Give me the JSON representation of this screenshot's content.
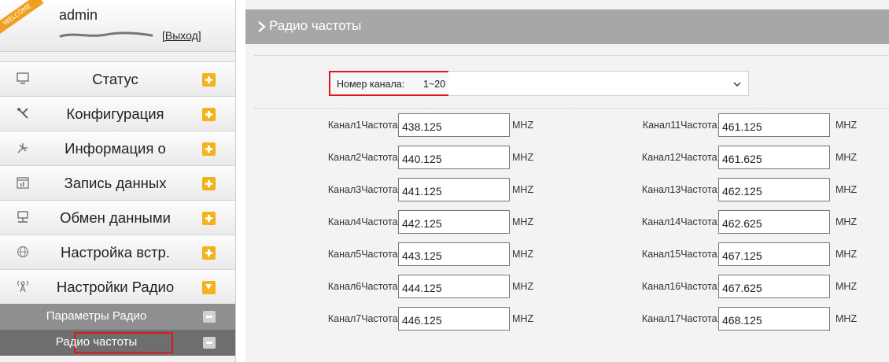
{
  "user": {
    "welcome_badge": "WELCOME",
    "name": "admin",
    "logout": "[Выход]"
  },
  "menu": [
    {
      "label": "Статус",
      "icon": "monitor-icon",
      "toggle": "plus"
    },
    {
      "label": "Конфигурация",
      "icon": "tools-icon",
      "toggle": "plus"
    },
    {
      "label": "Информация о",
      "icon": "info-icon",
      "toggle": "plus"
    },
    {
      "label": "Запись данных",
      "icon": "calendar-icon",
      "toggle": "plus"
    },
    {
      "label": "Обмен данными",
      "icon": "network-icon",
      "toggle": "plus"
    },
    {
      "label": "Настройка встр.",
      "icon": "globe-icon",
      "toggle": "plus"
    },
    {
      "label": "Настройки Радио",
      "icon": "antenna-icon",
      "toggle": "expanded"
    }
  ],
  "submenu": [
    {
      "label": "Параметры Радио"
    },
    {
      "label": "Радио частоты",
      "selected": true
    }
  ],
  "page": {
    "title": "Радио частоты"
  },
  "channel_select": {
    "label": "Номер канала:",
    "value": "1~20"
  },
  "frequencies": {
    "unit": "MHZ",
    "left": [
      {
        "label": "Канал1Частота:",
        "value": "438.125"
      },
      {
        "label": "Канал2Частота:",
        "value": "440.125"
      },
      {
        "label": "Канал3Частота:",
        "value": "441.125"
      },
      {
        "label": "Канал4Частота:",
        "value": "442.125"
      },
      {
        "label": "Канал5Частота:",
        "value": "443.125"
      },
      {
        "label": "Канал6Частота:",
        "value": "444.125"
      },
      {
        "label": "Канал7Частота:",
        "value": "446.125"
      }
    ],
    "right": [
      {
        "label": "Канал11Частота:",
        "value": "461.125"
      },
      {
        "label": "Канал12Частота:",
        "value": "461.625"
      },
      {
        "label": "Канал13Частота:",
        "value": "462.125"
      },
      {
        "label": "Канал14Частота:",
        "value": "462.625"
      },
      {
        "label": "Канал15Частота:",
        "value": "467.125"
      },
      {
        "label": "Канал16Частота:",
        "value": "467.625"
      },
      {
        "label": "Канал17Частота:",
        "value": "468.125"
      }
    ]
  },
  "colors": {
    "accent_toggle": "#f2b31c",
    "highlight_border": "#e0181e",
    "title_bar": "#a7a7a7"
  }
}
